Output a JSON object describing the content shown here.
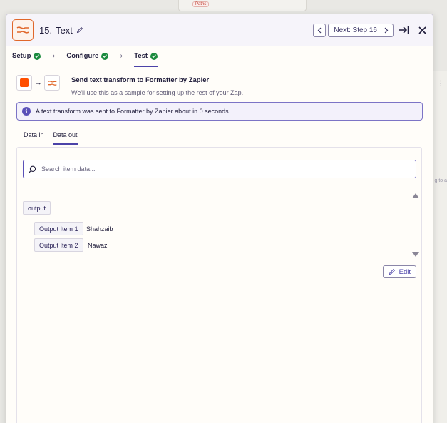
{
  "background": {
    "paths_label": "Paths",
    "right_more": "⋮",
    "right_text": "g to a"
  },
  "header": {
    "step_number": "15.",
    "step_name": "Text",
    "next_label": "Next: Step 16"
  },
  "step_tabs": [
    {
      "label": "Setup"
    },
    {
      "label": "Configure"
    },
    {
      "label": "Test"
    }
  ],
  "flow": {
    "title": "Send text transform to Formatter by Zapier",
    "subtitle": "We'll use this as a sample for setting up the rest of your Zap."
  },
  "banner": {
    "text": "A text transform was sent to Formatter by Zapier about in 0 seconds"
  },
  "data_tabs": [
    {
      "label": "Data in"
    },
    {
      "label": "Data out"
    }
  ],
  "search": {
    "placeholder": "Search item data..."
  },
  "output": {
    "root_label": "output",
    "items": [
      {
        "label": "Output Item 1",
        "value": "Shahzaib"
      },
      {
        "label": "Output Item 2",
        "value": "Nawaz"
      }
    ]
  },
  "edit_label": "Edit",
  "colors": {
    "accent": "#5a50b8",
    "brand_orange": "#ff4f00",
    "success": "#1c8b3f"
  }
}
